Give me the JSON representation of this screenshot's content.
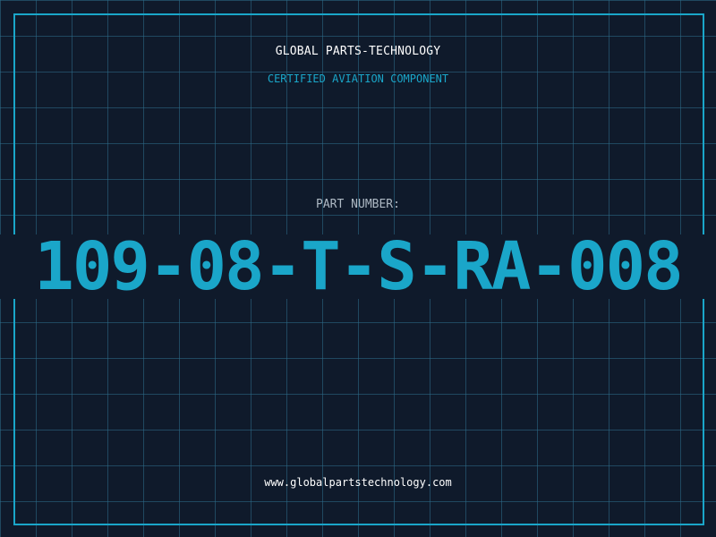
{
  "brand": {
    "name": "GLOBAL PARTS-TECHNOLOGY",
    "tagline": "CERTIFIED AVIATION COMPONENT"
  },
  "part": {
    "label": "PART NUMBER:",
    "number": "109-08-T-S-RA-008"
  },
  "footer": {
    "website": "www.globalpartstechnology.com"
  },
  "colors": {
    "background": "#0f1a2b",
    "grid": "#2d6e8c",
    "accent": "#1aa6c9",
    "text": "#ffffff",
    "muted": "#aeb9c4"
  }
}
